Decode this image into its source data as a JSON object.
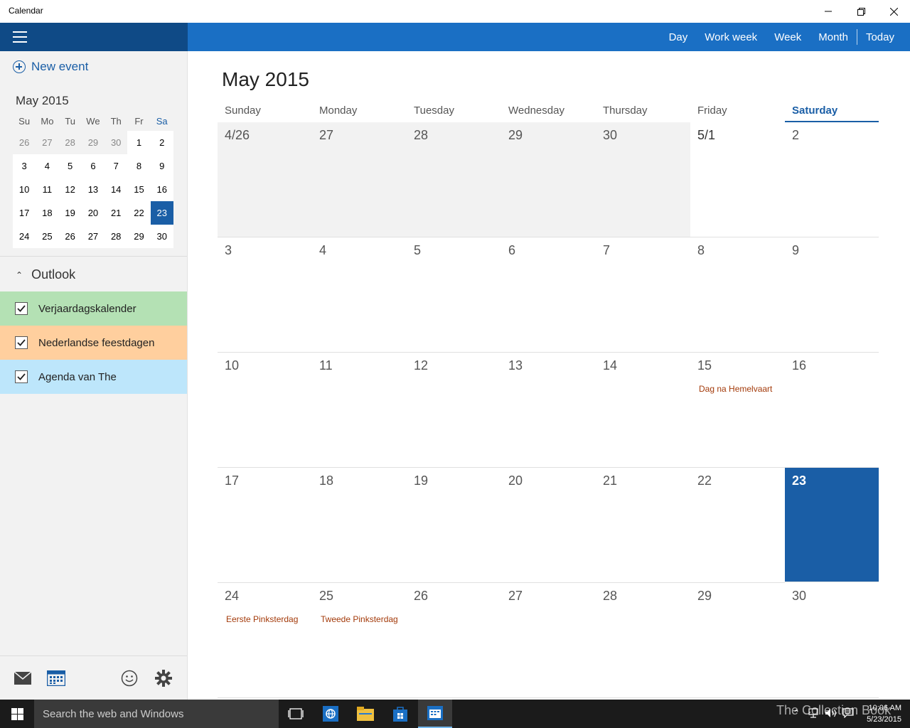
{
  "window": {
    "title": "Calendar"
  },
  "toolbar": {
    "views": [
      "Day",
      "Work week",
      "Week",
      "Month"
    ],
    "today_label": "Today"
  },
  "sidebar": {
    "new_event_label": "New event",
    "mini_calendar": {
      "title": "May 2015",
      "dow": [
        "Su",
        "Mo",
        "Tu",
        "We",
        "Th",
        "Fr",
        "Sa"
      ],
      "weeks": [
        [
          "26",
          "27",
          "28",
          "29",
          "30",
          "1",
          "2"
        ],
        [
          "3",
          "4",
          "5",
          "6",
          "7",
          "8",
          "9"
        ],
        [
          "10",
          "11",
          "12",
          "13",
          "14",
          "15",
          "16"
        ],
        [
          "17",
          "18",
          "19",
          "20",
          "21",
          "22",
          "23"
        ],
        [
          "24",
          "25",
          "26",
          "27",
          "28",
          "29",
          "30"
        ]
      ],
      "selected": "23"
    },
    "account_label": "Outlook",
    "calendars": [
      {
        "label": "Verjaardagskalender",
        "color": "#b4e1b4",
        "checked": true
      },
      {
        "label": "Nederlandse feestdagen",
        "color": "#ffcf9e",
        "checked": true
      },
      {
        "label": "Agenda van The",
        "color": "#bde6fb",
        "checked": true
      }
    ]
  },
  "main": {
    "title": "May 2015",
    "weekdays": [
      "Sunday",
      "Monday",
      "Tuesday",
      "Wednesday",
      "Thursday",
      "Friday",
      "Saturday"
    ],
    "weeks": [
      [
        "4/26",
        "27",
        "28",
        "29",
        "30",
        "5/1",
        "2"
      ],
      [
        "3",
        "4",
        "5",
        "6",
        "7",
        "8",
        "9"
      ],
      [
        "10",
        "11",
        "12",
        "13",
        "14",
        "15",
        "16"
      ],
      [
        "17",
        "18",
        "19",
        "20",
        "21",
        "22",
        "23"
      ],
      [
        "24",
        "25",
        "26",
        "27",
        "28",
        "29",
        "30"
      ]
    ],
    "events": {
      "2-5": "Dag na Hemelvaart",
      "4-0": "Eerste Pinksterdag",
      "4-1": "Tweede Pinksterdag"
    },
    "today": "23"
  },
  "taskbar": {
    "search_placeholder": "Search the web and Windows",
    "watermark": "The Collection Book",
    "time": "10:06 AM",
    "date": "5/23/2015"
  },
  "colors": {
    "accent": "#1a6fc4",
    "accent_dark": "#0f4a86",
    "holiday": "#a33a0a"
  }
}
